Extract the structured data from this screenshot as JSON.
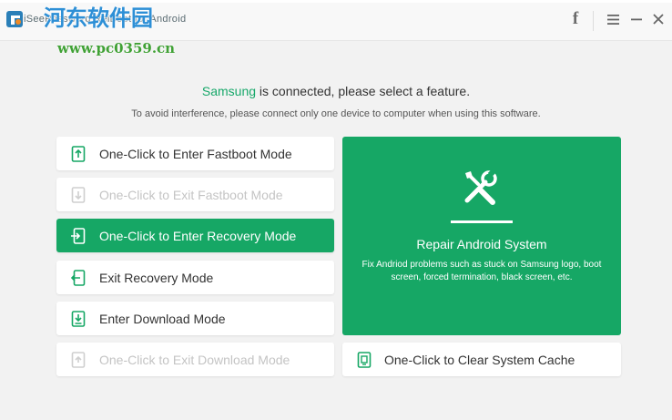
{
  "window": {
    "title": "iSeePassword ReiBoot for Android",
    "controls": {
      "facebook": "f",
      "menu": "≡",
      "minimize": "—",
      "close": "✕"
    }
  },
  "watermark": {
    "site_name": "河东软件园",
    "url": "www.pc0359.cn"
  },
  "main": {
    "heading_brand": "Samsung",
    "heading_rest": " is connected, please select a feature.",
    "subheading": "To avoid interference, please connect only one device to computer when using this software."
  },
  "features": [
    {
      "label": "One-Click to Enter Fastboot Mode",
      "state": "normal",
      "icon": "phone-upload-icon"
    },
    {
      "label": "One-Click to Exit Fastboot Mode",
      "state": "disabled",
      "icon": "phone-download-icon"
    },
    {
      "label": "One-Click to Enter Recovery Mode",
      "state": "active",
      "icon": "phone-enter-icon"
    },
    {
      "label": "Exit Recovery Mode",
      "state": "normal",
      "icon": "phone-exit-icon"
    },
    {
      "label": "Enter Download Mode",
      "state": "normal",
      "icon": "download-icon"
    },
    {
      "label": "One-Click to Exit Download Mode",
      "state": "disabled",
      "icon": "phone-exit-icon"
    }
  ],
  "repair": {
    "title": "Repair Android System",
    "description": "Fix Andriod problems such as stuck on Samsung logo, boot screen, forced termination, black screen, etc.",
    "icon": "tools-icon"
  },
  "cache": {
    "label": "One-Click to Clear System Cache",
    "icon": "phone-clean-icon"
  },
  "colors": {
    "accent": "#16a765",
    "disabled_text": "#c4c4c4",
    "background": "#f2f2f2"
  }
}
